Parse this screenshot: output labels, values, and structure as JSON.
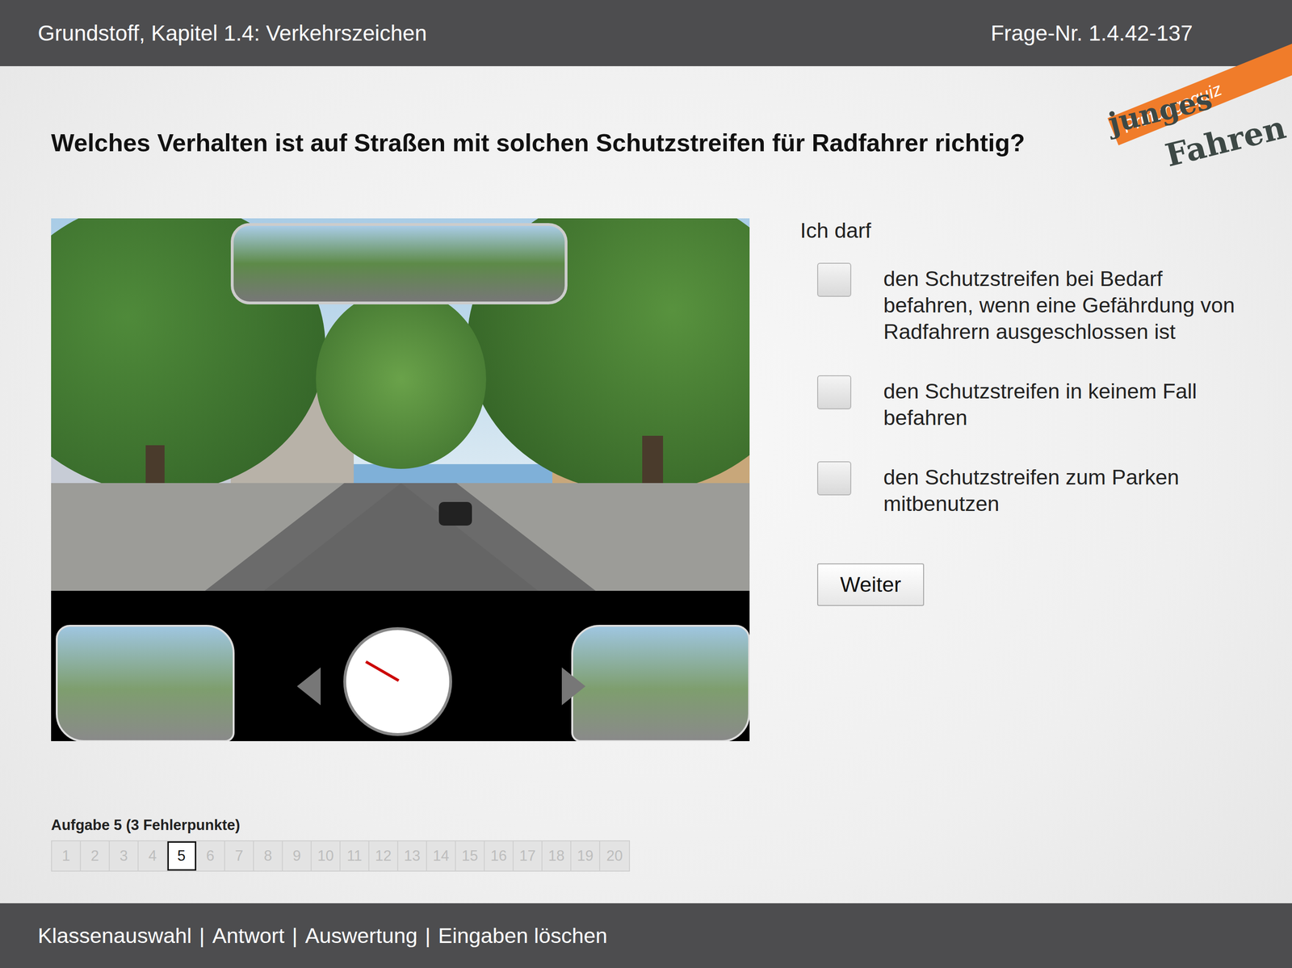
{
  "header": {
    "title": "Grundstoff, Kapitel 1.4: Verkehrszeichen",
    "question_number": "Frage-Nr. 1.4.42-137"
  },
  "logo": {
    "tag": "Prüfungsquiz",
    "line1": "junges",
    "line2": "Fahren"
  },
  "question": "Welches Verhalten ist auf Straßen mit solchen Schutzstreifen für Radfahrer richtig?",
  "answer_intro": "Ich darf",
  "options": [
    {
      "text": "den Schutzstreifen bei Bedarf befahren, wenn eine Gefährdung von Radfahrern ausgeschlossen ist",
      "checked": false
    },
    {
      "text": "den Schutzstreifen in keinem Fall befahren",
      "checked": false
    },
    {
      "text": "den Schutzstreifen zum Parken mitbenutzen",
      "checked": false
    }
  ],
  "button": "Weiter",
  "task": "Aufgabe 5 (3 Fehlerpunkte)",
  "pages": [
    {
      "label": "1",
      "selected": false
    },
    {
      "label": "2",
      "selected": false
    },
    {
      "label": "3",
      "selected": false
    },
    {
      "label": "4",
      "selected": false
    },
    {
      "label": "5",
      "selected": true
    },
    {
      "label": "6",
      "selected": false
    },
    {
      "label": "7",
      "selected": false
    },
    {
      "label": "8",
      "selected": false
    },
    {
      "label": "9",
      "selected": false
    },
    {
      "label": "10",
      "selected": false
    },
    {
      "label": "11",
      "selected": false
    },
    {
      "label": "12",
      "selected": false
    },
    {
      "label": "13",
      "selected": false
    },
    {
      "label": "14",
      "selected": false
    },
    {
      "label": "15",
      "selected": false
    },
    {
      "label": "16",
      "selected": false
    },
    {
      "label": "17",
      "selected": false
    },
    {
      "label": "18",
      "selected": false
    },
    {
      "label": "19",
      "selected": false
    },
    {
      "label": "20",
      "selected": false
    }
  ],
  "footer": {
    "links": [
      "Klassenauswahl",
      "Antwort",
      "Auswertung",
      "Eingaben löschen"
    ],
    "separator": "|"
  }
}
